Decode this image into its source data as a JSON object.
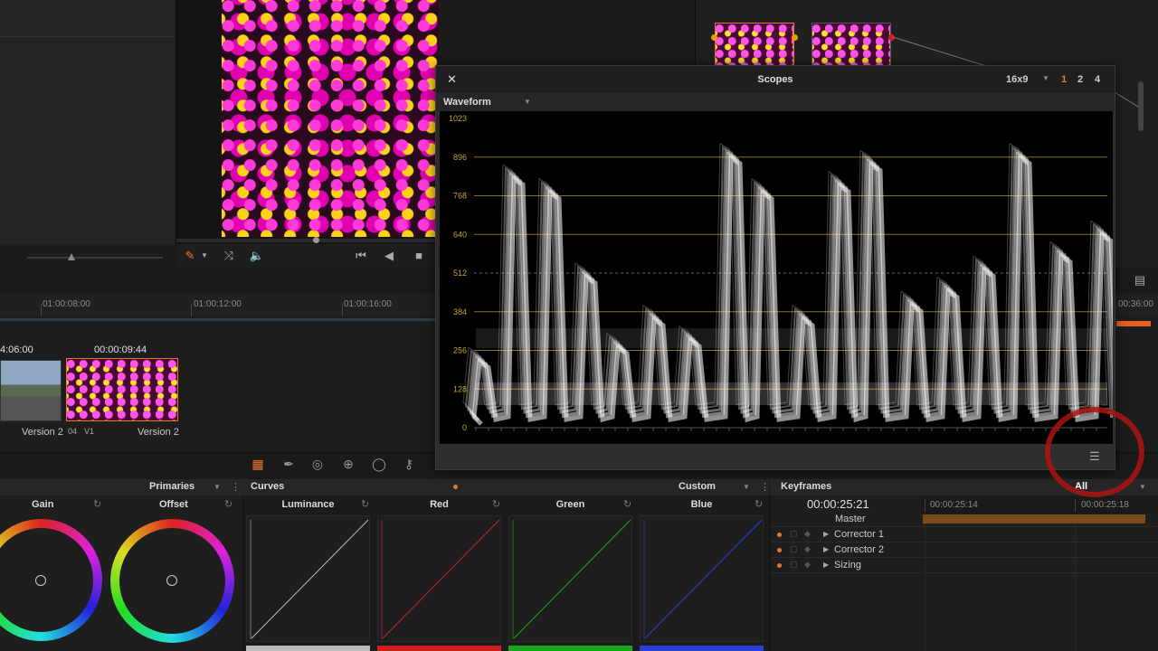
{
  "viewer": {
    "transport": {
      "jog_icon": "jog-icon"
    }
  },
  "timeline": {
    "ruler": [
      "01:00:08:00",
      "01:00:12:00",
      "01:00:16:00"
    ],
    "ruler_right": "00:36:00",
    "clips": [
      {
        "timecode": "4:06:00",
        "label": "Version 2"
      },
      {
        "timecode": "00:00:09:44",
        "label": "Version 2",
        "track": "04",
        "track2": "V1"
      }
    ]
  },
  "scopes": {
    "title": "Scopes",
    "ratio": "16x9",
    "layouts": [
      "1",
      "2",
      "4"
    ],
    "mode": "Waveform",
    "y_ticks": [
      "1023",
      "896",
      "768",
      "640",
      "512",
      "384",
      "256",
      "128",
      "0"
    ]
  },
  "primaries": {
    "title": "Primaries",
    "wheels": [
      {
        "label": "Gain"
      },
      {
        "label": "Offset"
      }
    ]
  },
  "curves": {
    "title": "Curves",
    "preset": "Custom",
    "channels": [
      {
        "label": "Luminance",
        "color": "#bbbbbb"
      },
      {
        "label": "Red",
        "color": "#d02020"
      },
      {
        "label": "Green",
        "color": "#1aa81a"
      },
      {
        "label": "Blue",
        "color": "#2a3ed8"
      }
    ]
  },
  "keyframes": {
    "title": "Keyframes",
    "filter": "All",
    "timecode": "00:00:25:21",
    "ruler": [
      "00:00:25:14",
      "00:00:25:18"
    ],
    "tracks": [
      "Master",
      "Corrector 1",
      "Corrector 2",
      "Sizing"
    ]
  },
  "colors": {
    "accent": "#e8772e",
    "panel": "#1c1c1c"
  }
}
